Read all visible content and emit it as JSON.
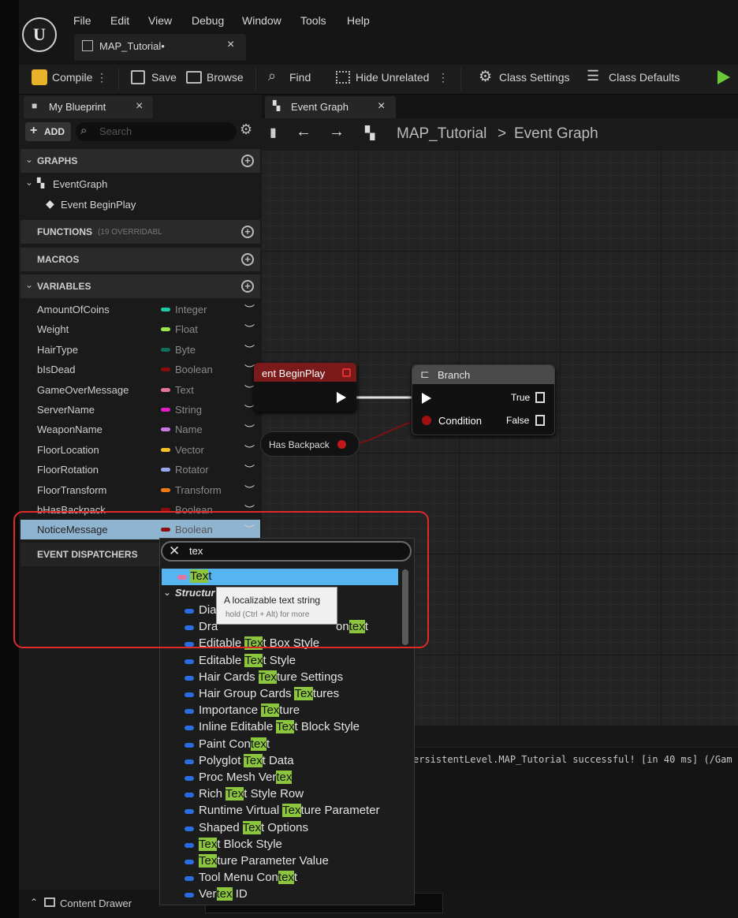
{
  "menu": [
    "File",
    "Edit",
    "View",
    "Debug",
    "Window",
    "Tools",
    "Help"
  ],
  "doc_tab": {
    "title": "MAP_Tutorial•",
    "close": "×"
  },
  "toolbar": {
    "compile": "Compile",
    "save": "Save",
    "browse": "Browse",
    "find": "Find",
    "hide_unrelated": "Hide Unrelated",
    "class_settings": "Class Settings",
    "class_defaults": "Class Defaults"
  },
  "my_blueprint": {
    "tab_label": "My Blueprint",
    "close": "×",
    "add_label": "ADD",
    "search_placeholder": "Search",
    "graphs_header": "GRAPHS",
    "event_graph": "EventGraph",
    "event_begin_play": "Event BeginPlay",
    "functions_header": "FUNCTIONS",
    "functions_count": "(19 OVERRIDABL",
    "macros_header": "MACROS",
    "variables_header": "VARIABLES",
    "variables": [
      {
        "name": "AmountOfCoins",
        "type": "Integer",
        "color": "#1fc9a4"
      },
      {
        "name": "Weight",
        "type": "Float",
        "color": "#9be84a"
      },
      {
        "name": "HairType",
        "type": "Byte",
        "color": "#0f6e5c"
      },
      {
        "name": "bIsDead",
        "type": "Boolean",
        "color": "#8a0d0d"
      },
      {
        "name": "GameOverMessage",
        "type": "Text",
        "color": "#e274a0"
      },
      {
        "name": "ServerName",
        "type": "String",
        "color": "#e21ec8"
      },
      {
        "name": "WeaponName",
        "type": "Name",
        "color": "#c97ae8"
      },
      {
        "name": "FloorLocation",
        "type": "Vector",
        "color": "#f0c024"
      },
      {
        "name": "FloorRotation",
        "type": "Rotator",
        "color": "#9aa8f0"
      },
      {
        "name": "FloorTransform",
        "type": "Transform",
        "color": "#f07a18"
      },
      {
        "name": "bHasBackpack",
        "type": "Boolean",
        "color": "#8a0d0d"
      },
      {
        "name": "NoticeMessage",
        "type": "Boolean",
        "color": "#8a0d0d"
      }
    ],
    "event_dispatchers_header": "EVENT DISPATCHERS"
  },
  "graph": {
    "tab_label": "Event Graph",
    "close": "×",
    "breadcrumb_root": "MAP_Tutorial",
    "breadcrumb_sep": ">",
    "breadcrumb_current": "Event Graph",
    "begin_play_node": "ent BeginPlay",
    "branch_node": {
      "title": "Branch",
      "true_label": "True",
      "false_label": "False",
      "condition_label": "Condition"
    },
    "getter_node": "Has Backpack"
  },
  "log_line": "ersistentLevel.MAP_Tutorial successful! [in 40 ms] (/Gam",
  "type_picker": {
    "search_value": "tex",
    "selected_item": {
      "pre": "",
      "hl": "Tex",
      "post": "t"
    },
    "category": "Structur",
    "tooltip_title": "A localizable text string",
    "tooltip_hint": "hold (Ctrl + Alt) for more",
    "items": [
      {
        "pre": "Dia",
        "hl": "",
        "post": ""
      },
      {
        "pre": "Dra",
        "hl": "",
        "post": ""
      },
      {
        "pre": "Editable ",
        "hl": "Tex",
        "post": "t Box Style"
      },
      {
        "pre": "Editable ",
        "hl": "Tex",
        "post": "t Style"
      },
      {
        "pre": "Hair Cards ",
        "hl": "Tex",
        "post": "ture Settings"
      },
      {
        "pre": "Hair Group Cards ",
        "hl": "Tex",
        "post": "tures"
      },
      {
        "pre": "Importance ",
        "hl": "Tex",
        "post": "ture"
      },
      {
        "pre": "Inline Editable ",
        "hl": "Tex",
        "post": "t Block Style"
      },
      {
        "pre": "Paint Con",
        "hl": "tex",
        "post": "t"
      },
      {
        "pre": "Polyglot ",
        "hl": "Tex",
        "post": "t Data"
      },
      {
        "pre": "Proc Mesh Ver",
        "hl": "tex",
        "post": ""
      },
      {
        "pre": "Rich ",
        "hl": "Tex",
        "post": "t Style Row"
      },
      {
        "pre": "Runtime Virtual ",
        "hl": "Tex",
        "post": "ture Parameter"
      },
      {
        "pre": "Shaped ",
        "hl": "Tex",
        "post": "t Options"
      },
      {
        "pre": "",
        "hl": "Tex",
        "post": "t Block Style"
      },
      {
        "pre": "",
        "hl": "Tex",
        "post": "ture Parameter Value"
      },
      {
        "pre": "Tool Menu Con",
        "hl": "tex",
        "post": "t"
      },
      {
        "pre": "Ver",
        "hl": "tex",
        "post": " ID"
      }
    ],
    "row2_tail": {
      "pre": "on",
      "hl": "tex",
      "post": "t"
    }
  },
  "bottom": {
    "content_drawer": "Content Drawer"
  }
}
